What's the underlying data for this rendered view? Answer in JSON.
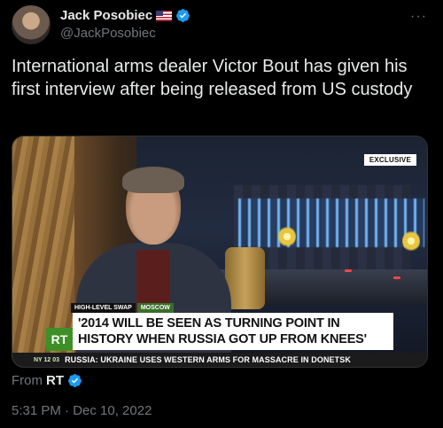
{
  "author": {
    "name": "Jack Posobiec",
    "handle": "@JackPosobiec",
    "flag_icon": "us-flag-icon",
    "verified_icon": "verified-badge-icon"
  },
  "more_label": "···",
  "tweet": {
    "text": "International arms dealer Victor Bout has given his first interview after being released from US custody"
  },
  "media": {
    "exclusive_label": "EXCLUSIVE",
    "tag_1": "HIGH-LEVEL SWAP",
    "tag_2": "MOSCOW",
    "logo_text": "RT",
    "headline_line_1": "'2014 WILL BE SEEN AS TURNING POINT IN",
    "headline_line_2": "HISTORY WHEN RUSSIA GOT UP FROM KNEES'",
    "ticker_time": "NY  12 03",
    "ticker_text": "RUSSIA: UKRAINE USES WESTERN ARMS FOR MASSACRE IN DONETSK"
  },
  "attribution": {
    "prefix": "From",
    "source": "RT"
  },
  "timestamp": "5:31 PM · Dec 10, 2022",
  "colors": {
    "background": "#000000",
    "text": "#e7e9ea",
    "secondary": "#71767b",
    "verified": "#1d9bf0",
    "rt_green": "#3f8f27"
  }
}
